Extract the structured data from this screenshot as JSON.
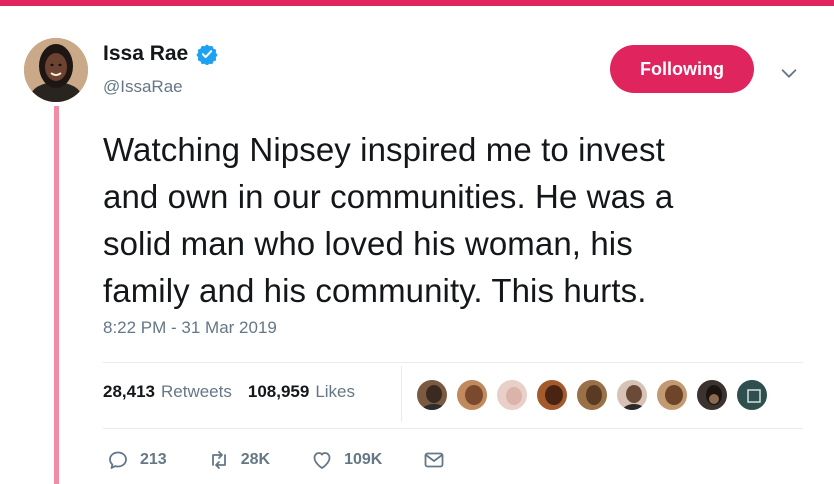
{
  "tweet": {
    "author": {
      "name": "Issa Rae",
      "handle": "@IssaRae",
      "verified": true
    },
    "follow_button": "Following",
    "text_lines": [
      "Watching Nipsey inspired me to invest",
      "and own in our communities. He was a",
      "solid man who loved his woman, his",
      "family and his community. This hurts."
    ],
    "timestamp": "8:22 PM - 31 Mar 2019",
    "stats": {
      "retweets": {
        "count": "28,413",
        "label": "Retweets"
      },
      "likes": {
        "count": "108,959",
        "label": "Likes"
      }
    },
    "actions": {
      "replies": "213",
      "retweets": "28K",
      "likes": "109K"
    }
  },
  "colors": {
    "accent": "#e0245e",
    "thread_line": "#f08ca3",
    "verified": "#1da1f2",
    "muted": "#657786"
  }
}
